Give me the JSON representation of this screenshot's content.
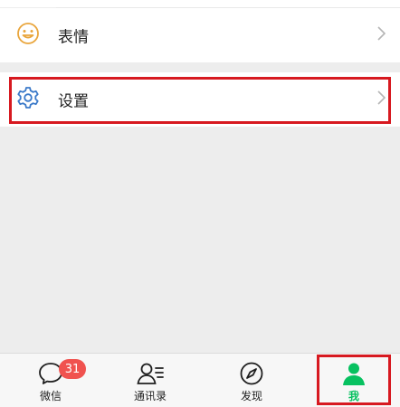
{
  "rows": {
    "emoji": {
      "label": "表情",
      "icon": "smiley-icon"
    },
    "settings": {
      "label": "设置",
      "icon": "gear-icon"
    }
  },
  "tabbar": {
    "tabs": [
      {
        "label": "微信",
        "icon": "chat-bubble-icon",
        "badge": "31"
      },
      {
        "label": "通讯录",
        "icon": "contacts-icon"
      },
      {
        "label": "发现",
        "icon": "compass-icon"
      },
      {
        "label": "我",
        "icon": "person-icon",
        "selected": true
      }
    ]
  },
  "colors": {
    "accent_green": "#07c160",
    "settings_icon_blue": "#3a79c9",
    "emoji_icon_orange": "#e9a53b",
    "badge_red": "#f0524f",
    "highlight_red": "#d71920"
  }
}
